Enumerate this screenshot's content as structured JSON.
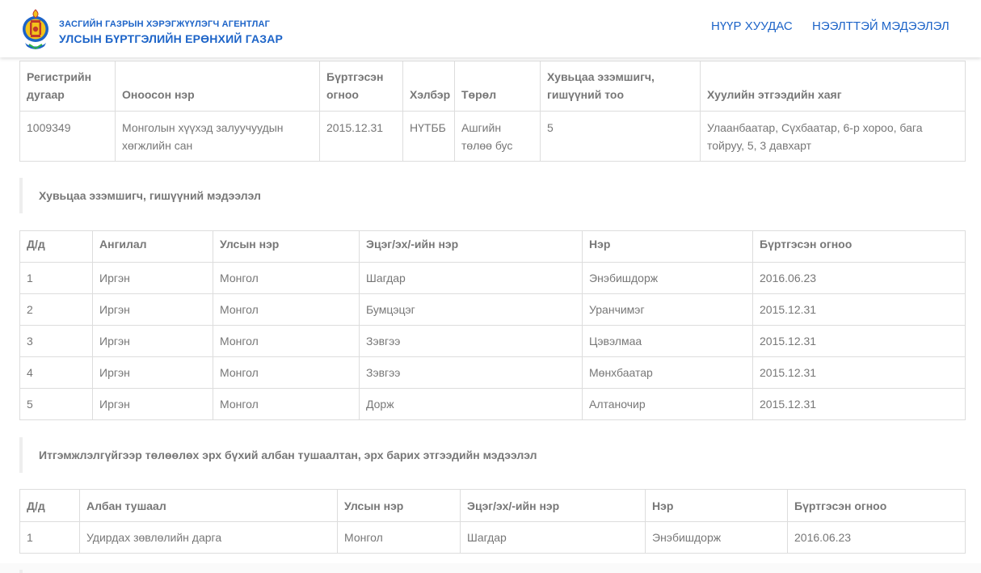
{
  "header": {
    "agency_line1": "ЗАСГИЙН ГАЗРЫН ХЭРЭГЖҮҮЛЭГЧ АГЕНТЛАГ",
    "agency_line2": "УЛСЫН БҮРТГЭЛИЙН ЕРӨНХИЙ ГАЗАР",
    "nav": {
      "home": "НҮҮР ХУУДАС",
      "open_data": "НЭЭЛТТЭЙ МЭДЭЭЛЭЛ"
    },
    "brand_color": "#1d64c8",
    "logo_icon": "soyombo-emblem-icon"
  },
  "entity_table": {
    "headers": [
      "Регистрийн дугаар",
      "Оноосон нэр",
      "Бүртгэсэн огноо",
      "Хэлбэр",
      "Төрөл",
      "Хувьцаа эзэмшигч, гишүүний тоо",
      "Хуулийн этгээдийн хаяг"
    ],
    "row": {
      "registry_no": "1009349",
      "name": "Монголын хүүхэд залуучуудын хөгжлийн сан",
      "registered": "2015.12.31",
      "form": "НҮТББ",
      "type": "Ашгийн төлөө бус",
      "member_count": "5",
      "address": "Улаанбаатар, Сүхбаатар, 6-р хороо, бага тойруу, 5, 3 давхарт"
    }
  },
  "members_section": {
    "title": "Хувьцаа эзэмшигч, гишүүний мэдээлэл",
    "headers": [
      "Д/д",
      "Ангилал",
      "Улсын нэр",
      "Эцэг/эх/-ийн нэр",
      "Нэр",
      "Бүртгэсэн огноо"
    ],
    "rows": [
      [
        "1",
        "Иргэн",
        "Монгол",
        "Шагдар",
        "Энэбишдорж",
        "2016.06.23"
      ],
      [
        "2",
        "Иргэн",
        "Монгол",
        "Бумцэцэг",
        "Уранчимэг",
        "2015.12.31"
      ],
      [
        "3",
        "Иргэн",
        "Монгол",
        "Зэвгээ",
        "Цэвэлмаа",
        "2015.12.31"
      ],
      [
        "4",
        "Иргэн",
        "Монгол",
        "Зэвгээ",
        "Мөнхбаатар",
        "2015.12.31"
      ],
      [
        "5",
        "Иргэн",
        "Монгол",
        "Дорж",
        "Алтаночир",
        "2015.12.31"
      ]
    ]
  },
  "officers_section": {
    "title": "Итгэмжлэлгүйгээр төлөөлөх эрх бүхий албан тушаалтан, эрх барих этгээдийн мэдээлэл",
    "headers": [
      "Д/д",
      "Албан тушаал",
      "Улсын нэр",
      "Эцэг/эх/-ийн нэр",
      "Нэр",
      "Бүртгэсэн огноо"
    ],
    "rows": [
      [
        "1",
        "Удирдах зөвлөлийн дарга",
        "Монгол",
        "Шагдар",
        "Энэбишдорж",
        "2016.06.23"
      ]
    ]
  }
}
